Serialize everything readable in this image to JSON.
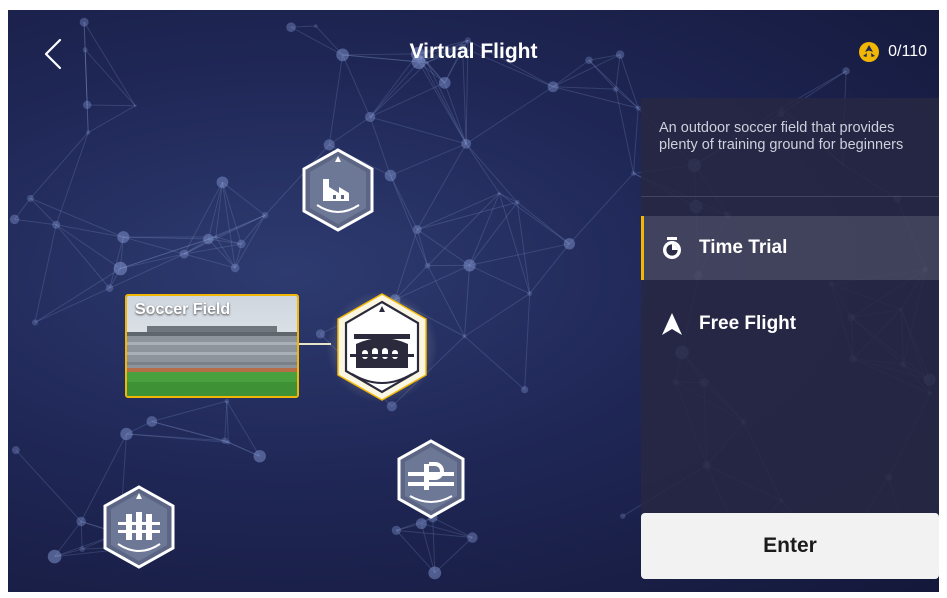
{
  "header": {
    "title": "Virtual Flight",
    "back_icon": "chevron-left-icon",
    "counter_icon": "drone-icon",
    "counter": "0/110",
    "accent_color": "#f2b705"
  },
  "map": {
    "selected_preview": {
      "label": "Soccer Field"
    },
    "badges": [
      {
        "name": "factory",
        "label": "FACTORY",
        "icon": "factory-icon"
      },
      {
        "name": "stadium",
        "label": "STADIUM",
        "icon": "stadium-icon",
        "selected": true
      },
      {
        "name": "parking",
        "label": "PARKING",
        "icon": "parking-icon"
      },
      {
        "name": "skycity",
        "label": "SKYCITY",
        "icon": "skycity-icon"
      }
    ]
  },
  "panel": {
    "description": "An outdoor soccer field that provides plenty of training ground for beginners",
    "modes": [
      {
        "label": "Time Trial",
        "icon": "stopwatch-icon",
        "selected": true
      },
      {
        "label": "Free Flight",
        "icon": "navigation-arrow-icon",
        "selected": false
      }
    ],
    "enter_label": "Enter"
  }
}
